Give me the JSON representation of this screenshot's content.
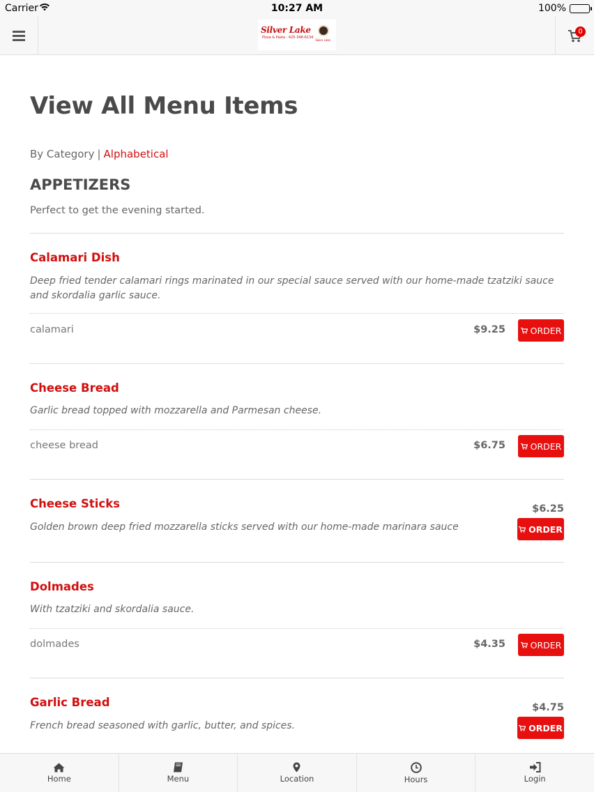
{
  "status_bar": {
    "carrier": "Carrier",
    "time": "10:27 AM",
    "battery": "100%"
  },
  "header": {
    "cart_count": "0",
    "logo": {
      "name": "Silver Lake",
      "tagline": "Pizza & Pasta · 425-348-6134",
      "mascot": "Swiss Lake"
    }
  },
  "page": {
    "title": "View All Menu Items",
    "view_by_category": "By Category",
    "separator": "|",
    "view_alphabetical": "Alphabetical"
  },
  "category": {
    "title": "APPETIZERS",
    "description": "Perfect to get the evening started."
  },
  "order_label": "ORDER",
  "items": [
    {
      "name": "Calamari Dish",
      "description": "Deep fried tender calamari rings marinated in our special sauce served with our home-made tzatziki sauce and skordalia garlic sauce.",
      "size": "calamari",
      "price": "$9.25"
    },
    {
      "name": "Cheese Bread",
      "description": "Garlic bread topped with mozzarella and Parmesan cheese.",
      "size": "cheese bread",
      "price": "$6.75"
    },
    {
      "name": "Cheese Sticks",
      "description": "Golden brown deep fried mozzarella sticks served with our home-made marinara sauce",
      "price": "$6.25"
    },
    {
      "name": "Dolmades",
      "description": "With tzatziki and skordalia sauce.",
      "size": "dolmades",
      "price": "$4.35"
    },
    {
      "name": "Garlic Bread",
      "description": "French bread seasoned with garlic, butter, and spices.",
      "price": "$4.75"
    }
  ],
  "tabbar": [
    {
      "label": "Home",
      "icon": "home-icon"
    },
    {
      "label": "Menu",
      "icon": "book-icon"
    },
    {
      "label": "Location",
      "icon": "map-pin-icon"
    },
    {
      "label": "Hours",
      "icon": "clock-icon"
    },
    {
      "label": "Login",
      "icon": "login-icon"
    }
  ],
  "colors": {
    "accent": "#e80f0f",
    "link": "#d10f0f",
    "bar_bg": "#f7f7f7"
  }
}
